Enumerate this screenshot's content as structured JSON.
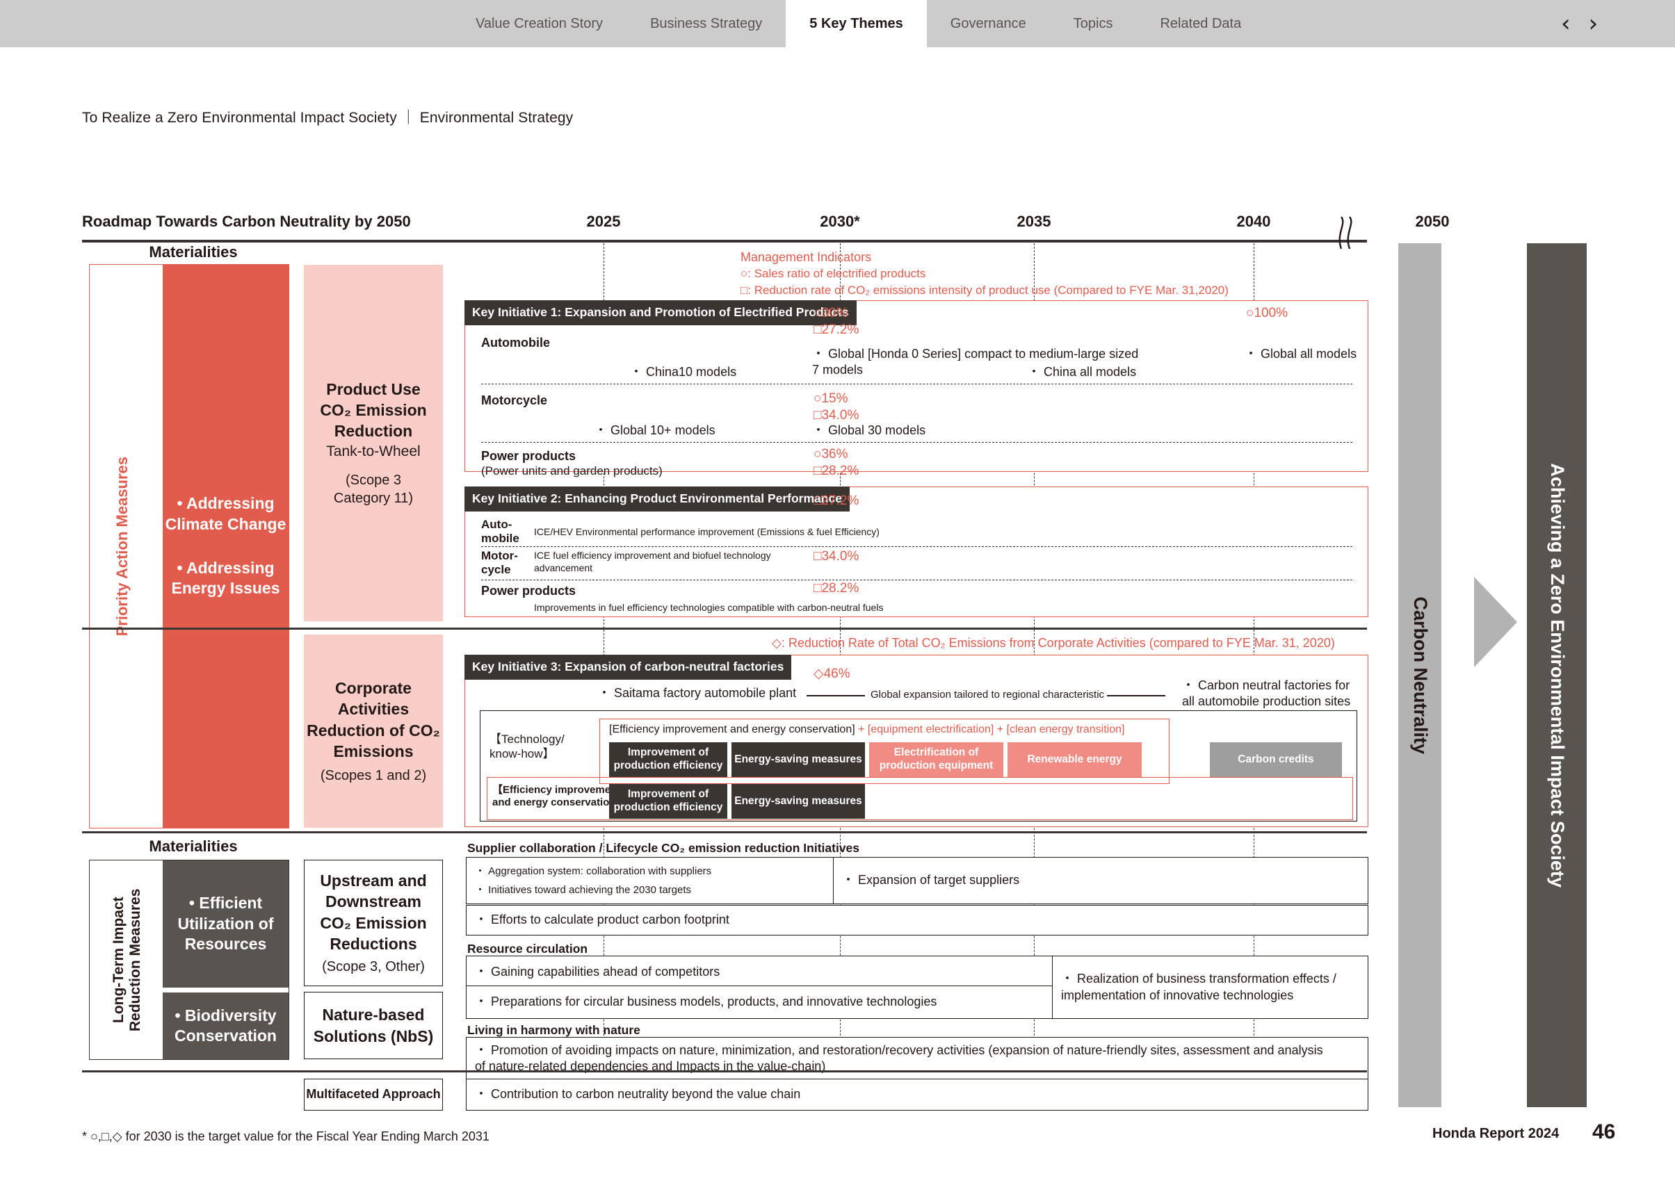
{
  "nav": {
    "tabs": [
      {
        "label": "Value Creation Story",
        "active": false
      },
      {
        "label": "Business Strategy",
        "active": false
      },
      {
        "label": "5 Key Themes",
        "active": true
      },
      {
        "label": "Governance",
        "active": false
      },
      {
        "label": "Topics",
        "active": false
      },
      {
        "label": "Related Data",
        "active": false
      }
    ],
    "prev_icon": "‹",
    "next_icon": "›"
  },
  "breadcrumb": "To Realize a Zero Environmental Impact Society ｜ Environmental Strategy",
  "roadmap": {
    "title": "Roadmap Towards Carbon Neutrality by 2050",
    "years": [
      "2025",
      "2030*",
      "2035",
      "2040",
      "2050"
    ],
    "materialities_header_top": "Materialities",
    "materialities_header_bottom": "Materialities"
  },
  "left_rail": {
    "priority_label": "Priority Action Measures",
    "longterm_label": "Long-Term Impact\nReduction Measures",
    "priority_items": "• Addressing\nClimate\nChange\n\n• Addressing\nEnergy Issues",
    "priority_item_1": "• Addressing Climate Change",
    "priority_item_2": "• Addressing Energy Issues",
    "longterm_item_1": "• Efficient Utilization of Resources",
    "longterm_item_2": "• Biodiversity Conservation"
  },
  "categories": {
    "product_use": {
      "title": "Product Use\nCO₂ Emission\nReduction",
      "sub": "Tank-to-Wheel",
      "note": "(Scope 3\nCategory 11)"
    },
    "corporate": {
      "title": "Corporate\nActivities\nReduction of CO₂\nEmissions",
      "note": "(Scopes 1 and 2)"
    },
    "upstream": {
      "title": "Upstream and\nDownstream\nCO₂ Emission\nReductions",
      "note": "(Scope 3, Other)"
    },
    "nbs": {
      "title": "Nature-based\nSolutions (NbS)"
    },
    "multifaceted": {
      "title": "Multifaceted Approach"
    }
  },
  "management_indicators": {
    "heading": "Management Indicators",
    "line1": "○: Sales ratio of electrified products",
    "line2": "□: Reduction rate of CO₂ emissions intensity of product use (Compared to FYE Mar. 31,2020)",
    "corporate_line": "◇: Reduction Rate of Total CO₂ Emissions from Corporate Activities (compared to FYE Mar. 31, 2020)"
  },
  "ki1": {
    "title": "Key Initiative 1: Expansion and Promotion of Electrified Products",
    "auto_label": "Automobile",
    "auto_2030_circle": "○30%",
    "auto_2030_square": "□27.2%",
    "auto_2040_circle": "○100%",
    "auto_2025_bullet": "・ China10 models",
    "auto_2030_bullet": "・ Global [Honda 0 Series] compact to medium-large sized\n 7 models",
    "auto_2035_bullet": "・ China all models",
    "auto_2040_bullet": "・ Global all models",
    "moto_label": "Motorcycle",
    "moto_2030_circle": "○15%",
    "moto_2030_square": "□34.0%",
    "moto_2025_bullet": "・ Global 10+ models",
    "moto_2030_bullet": "・ Global 30 models",
    "power_label": "Power products",
    "power_sub": "(Power units and garden products)",
    "power_2030_circle": "○36%",
    "power_2030_square": "□28.2%"
  },
  "ki2": {
    "title": "Key Initiative 2: Enhancing Product Environmental Performance",
    "header_square": "□27.2%",
    "auto_label": "Auto-\nmobile",
    "auto_desc": "ICE/HEV Environmental performance improvement (Emissions & fuel Efficiency)",
    "moto_label": "Motor-\ncycle",
    "moto_desc": "ICE fuel efficiency improvement and biofuel technology\nadvancement",
    "moto_square": "□34.0%",
    "power_label": "Power products",
    "power_desc": "Improvements in fuel efficiency technologies compatible with carbon-neutral fuels",
    "power_square": "□28.2%"
  },
  "ki3": {
    "title": "Key Initiative 3: Expansion of carbon-neutral factories",
    "diamond": "◇46%",
    "bullet_2025": "・ Saitama factory automobile plant",
    "mid_label": "Global expansion tailored to regional characteristic",
    "bullet_2040": "・ Carbon neutral factories for\nall automobile production sites",
    "tech_label": "【Technology/\nknow-how】",
    "formula_black": "[Efficiency improvement and energy conservation]",
    "formula_red": " + [equipment electrification] + [clean energy transition]",
    "chips_row1": [
      {
        "label": "Improvement of\nproduction efficiency",
        "style": "dark"
      },
      {
        "label": "Energy-saving measures",
        "style": "dark"
      },
      {
        "label": "Electrification of\nproduction equipment",
        "style": "pink"
      },
      {
        "label": "Renewable energy",
        "style": "pink"
      }
    ],
    "carbon_credits": {
      "label": "Carbon credits",
      "style": "gray"
    },
    "eff_label": "【Efficiency improvements\nand energy conservation】",
    "chips_row2": [
      {
        "label": "Improvement of\nproduction efficiency",
        "style": "dark"
      },
      {
        "label": "Energy-saving measures",
        "style": "dark"
      }
    ]
  },
  "bottom": {
    "supplier_header": "Supplier collaboration / Lifecycle CO₂ emission reduction Initiatives",
    "supplier_box1_line1": "・ Aggregation system: collaboration with suppliers",
    "supplier_box1_line2": "・ Initiatives toward achieving the 2030 targets",
    "supplier_box2": "・ Expansion of target suppliers",
    "footprint_box": "・ Efforts to calculate product carbon footprint",
    "resource_header": "Resource circulation",
    "resource_box1": "・ Gaining capabilities ahead of competitors",
    "resource_box2": "・ Preparations for circular business models, products, and innovative technologies",
    "resource_box3": "・ Realization of business transformation effects /\n implementation of innovative technologies",
    "nature_header": "Living in harmony with nature",
    "nature_box": "・ Promotion of avoiding impacts on nature, minimization, and restoration/recovery activities (expansion of nature-friendly sites, assessment and analysis\n of nature-related dependencies and Impacts in the value-chain)",
    "multifaceted_box": "・ Contribution to carbon neutrality beyond the value chain"
  },
  "right_bars": {
    "carbon_neutrality": "Carbon Neutrality",
    "goal": "Achieving a Zero Environmental Impact Society"
  },
  "footer": {
    "footnote": "* ○,□,◇ for 2030 is the target value for the Fiscal Year Ending March 2031",
    "report": "Honda Report 2024",
    "page": "46"
  },
  "colors": {
    "accent_red": "#E25C4E",
    "light_pink": "#F9CEC9",
    "chip_pink": "#F08C83",
    "dark": "#3A3531",
    "gray_bar": "#B3B3B3",
    "goal_bar": "#595450",
    "nav_bg": "#CCCCCC"
  }
}
